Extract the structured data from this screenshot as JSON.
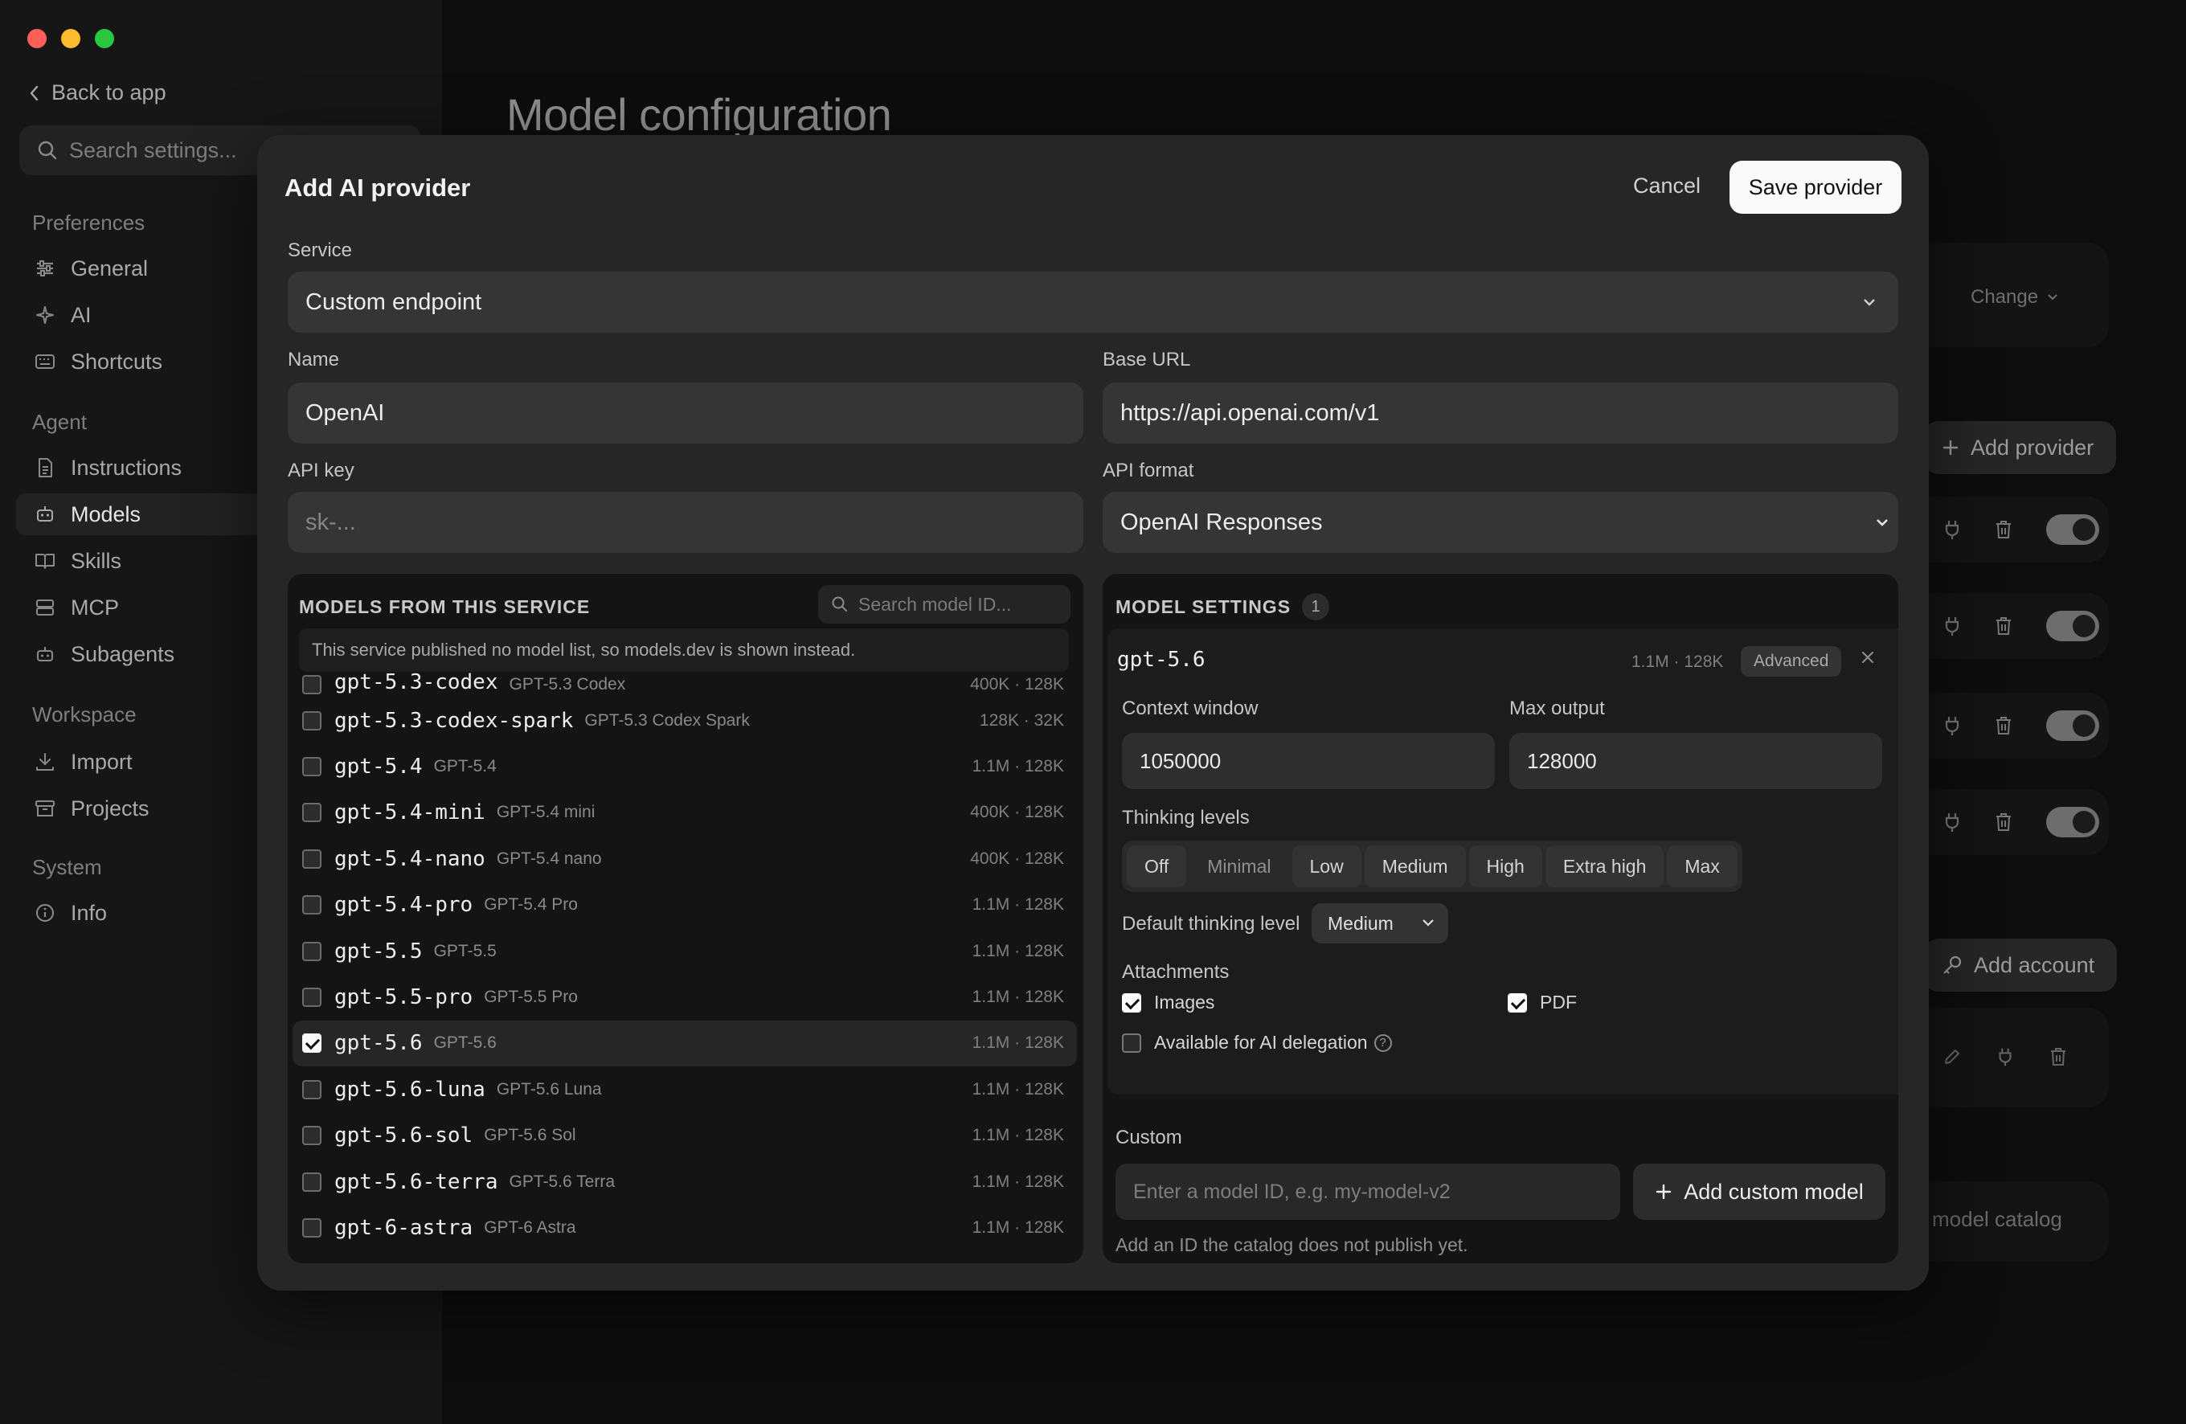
{
  "sidebar": {
    "back_label": "Back to app",
    "search_placeholder": "Search settings...",
    "sections": [
      {
        "label": "Preferences",
        "items": [
          {
            "label": "General",
            "icon": "sliders-icon"
          },
          {
            "label": "AI",
            "icon": "sparkles-icon"
          },
          {
            "label": "Shortcuts",
            "icon": "keyboard-icon"
          }
        ]
      },
      {
        "label": "Agent",
        "items": [
          {
            "label": "Instructions",
            "icon": "document-icon"
          },
          {
            "label": "Models",
            "icon": "robot-icon",
            "active": true
          },
          {
            "label": "Skills",
            "icon": "book-icon"
          },
          {
            "label": "MCP",
            "icon": "server-icon"
          },
          {
            "label": "Subagents",
            "icon": "bot-icon"
          }
        ]
      },
      {
        "label": "Workspace",
        "items": [
          {
            "label": "Import",
            "icon": "download-icon"
          },
          {
            "label": "Projects",
            "icon": "archive-icon"
          }
        ]
      },
      {
        "label": "System",
        "items": [
          {
            "label": "Info",
            "icon": "info-icon"
          }
        ]
      }
    ]
  },
  "background": {
    "page_title": "Model configuration",
    "change_label": "Change",
    "add_provider_label": "Add provider",
    "add_account_label": "Add account",
    "catalog_label": "model catalog"
  },
  "modal": {
    "title": "Add AI provider",
    "cancel_label": "Cancel",
    "save_label": "Save provider",
    "service": {
      "label": "Service",
      "value": "Custom endpoint"
    },
    "name": {
      "label": "Name",
      "value": "OpenAI"
    },
    "base_url": {
      "label": "Base URL",
      "value": "https://api.openai.com/v1"
    },
    "api_key": {
      "label": "API key",
      "placeholder": "sk-..."
    },
    "api_format": {
      "label": "API format",
      "value": "OpenAI Responses"
    },
    "models_panel": {
      "heading": "MODELS FROM THIS SERVICE",
      "search_placeholder": "Search model ID...",
      "notice": "This service published no model list, so models.dev is shown instead.",
      "models": [
        {
          "id": "gpt-5.3-codex",
          "name": "GPT-5.3 Codex",
          "meta": "400K · 128K",
          "checked": false
        },
        {
          "id": "gpt-5.3-codex-spark",
          "name": "GPT-5.3 Codex Spark",
          "meta": "128K · 32K",
          "checked": false
        },
        {
          "id": "gpt-5.4",
          "name": "GPT-5.4",
          "meta": "1.1M · 128K",
          "checked": false
        },
        {
          "id": "gpt-5.4-mini",
          "name": "GPT-5.4 mini",
          "meta": "400K · 128K",
          "checked": false
        },
        {
          "id": "gpt-5.4-nano",
          "name": "GPT-5.4 nano",
          "meta": "400K · 128K",
          "checked": false
        },
        {
          "id": "gpt-5.4-pro",
          "name": "GPT-5.4 Pro",
          "meta": "1.1M · 128K",
          "checked": false
        },
        {
          "id": "gpt-5.5",
          "name": "GPT-5.5",
          "meta": "1.1M · 128K",
          "checked": false
        },
        {
          "id": "gpt-5.5-pro",
          "name": "GPT-5.5 Pro",
          "meta": "1.1M · 128K",
          "checked": false
        },
        {
          "id": "gpt-5.6",
          "name": "GPT-5.6",
          "meta": "1.1M · 128K",
          "checked": true
        },
        {
          "id": "gpt-5.6-luna",
          "name": "GPT-5.6 Luna",
          "meta": "1.1M · 128K",
          "checked": false
        },
        {
          "id": "gpt-5.6-sol",
          "name": "GPT-5.6 Sol",
          "meta": "1.1M · 128K",
          "checked": false
        },
        {
          "id": "gpt-5.6-terra",
          "name": "GPT-5.6 Terra",
          "meta": "1.1M · 128K",
          "checked": false
        },
        {
          "id": "gpt-6-astra",
          "name": "GPT-6 Astra",
          "meta": "1.1M · 128K",
          "checked": false
        }
      ]
    },
    "settings_panel": {
      "heading": "MODEL SETTINGS",
      "count": "1",
      "model_id": "gpt-5.6",
      "meta": "1.1M · 128K",
      "advanced_label": "Advanced",
      "context_window": {
        "label": "Context window",
        "value": "1050000"
      },
      "max_output": {
        "label": "Max output",
        "value": "128000"
      },
      "thinking_levels_label": "Thinking levels",
      "thinking_levels": [
        {
          "label": "Off",
          "enabled": true
        },
        {
          "label": "Minimal",
          "enabled": false
        },
        {
          "label": "Low",
          "enabled": true
        },
        {
          "label": "Medium",
          "enabled": true
        },
        {
          "label": "High",
          "enabled": true
        },
        {
          "label": "Extra high",
          "enabled": true
        },
        {
          "label": "Max",
          "enabled": true
        }
      ],
      "default_level_label": "Default thinking level",
      "default_level_value": "Medium",
      "attachments_label": "Attachments",
      "images_label": "Images",
      "images_checked": true,
      "pdf_label": "PDF",
      "pdf_checked": true,
      "delegation_label": "Available for AI delegation",
      "delegation_checked": false,
      "custom_label": "Custom",
      "custom_placeholder": "Enter a model ID, e.g. my-model-v2",
      "add_custom_label": "Add custom model",
      "custom_hint": "Add an ID the catalog does not publish yet."
    }
  }
}
